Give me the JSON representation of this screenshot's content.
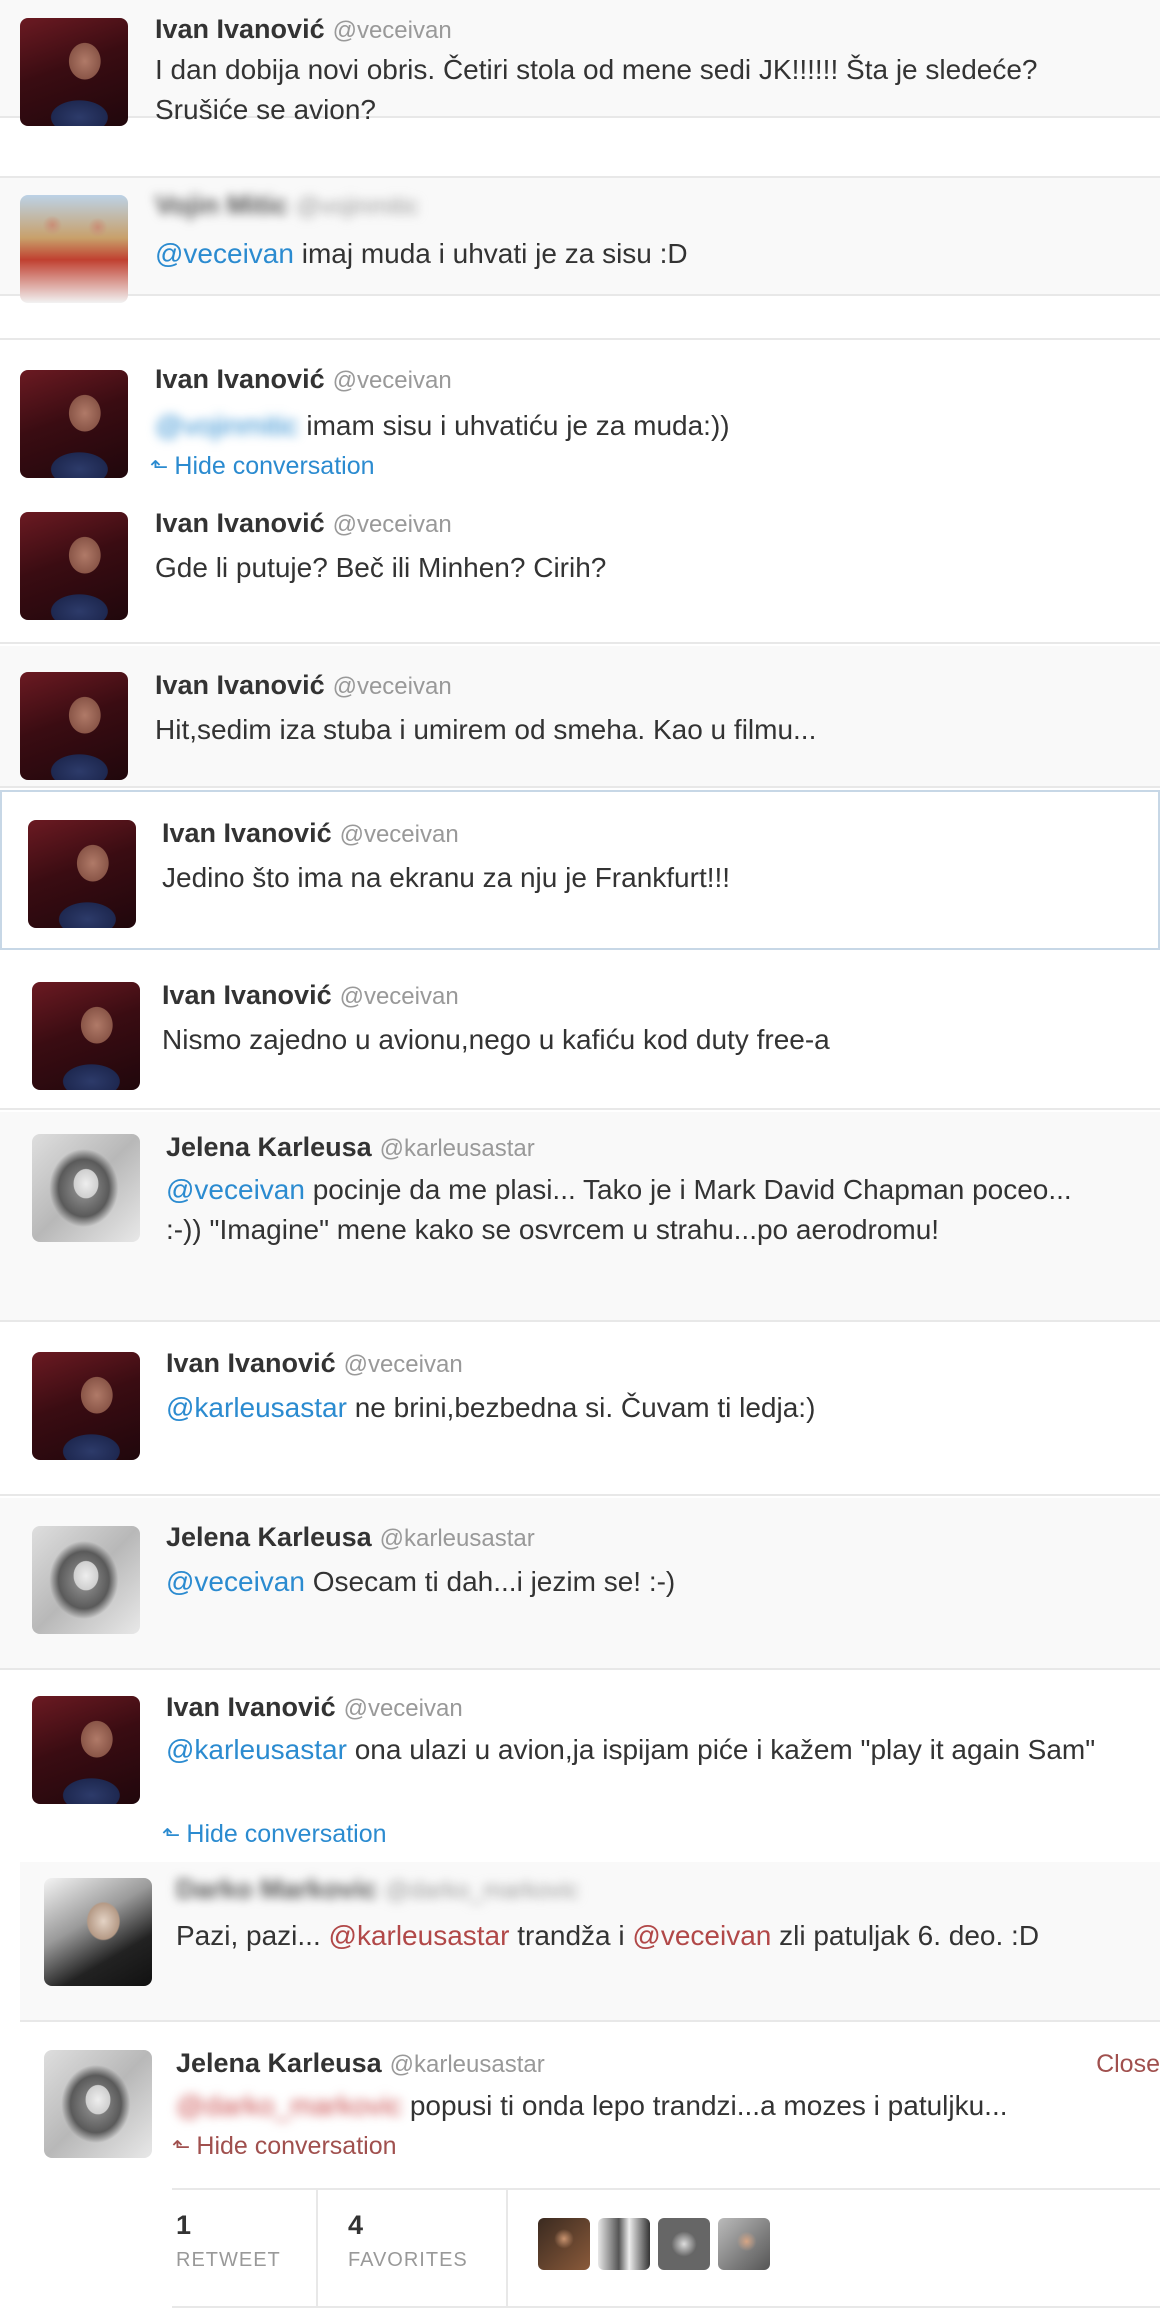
{
  "tweets": [
    {
      "name": "Ivan Ivanović",
      "handle": "@veceivan",
      "text": "I dan dobija novi obris. Četiri stola od mene sedi JK!!!!!! Šta je sledeće? Srušiće se avion?"
    },
    {
      "name": "Vojin Mitic",
      "handle": "@vojinmitic",
      "mention": "@veceivan",
      "text": " imaj muda i uhvati je za sisu :D"
    },
    {
      "name": "Ivan Ivanović",
      "handle": "@veceivan",
      "mention": "@vojinmitic",
      "text": " imam sisu i uhvatiću je za muda:))",
      "action": "Hide conversation"
    },
    {
      "name": "Ivan Ivanović",
      "handle": "@veceivan",
      "text": "Gde li putuje? Beč ili Minhen? Cirih?"
    },
    {
      "name": "Ivan Ivanović",
      "handle": "@veceivan",
      "text": "Hit,sedim iza stuba i umirem od smeha. Kao u filmu..."
    },
    {
      "name": "Ivan Ivanović",
      "handle": "@veceivan",
      "text": "Jedino što ima na ekranu za nju je Frankfurt!!!"
    },
    {
      "name": "Ivan Ivanović",
      "handle": "@veceivan",
      "text": "Nismo zajedno u avionu,nego u kafiću kod duty free-a"
    },
    {
      "name": "Jelena Karleusa",
      "handle": "@karleusastar",
      "mention": "@veceivan",
      "text": " pocinje da me plasi... Tako je i Mark David Chapman poceo... :-)) \"Imagine\" mene kako se osvrcem u strahu...po aerodromu!"
    },
    {
      "name": "Ivan Ivanović",
      "handle": "@veceivan",
      "mention": "@karleusastar",
      "text": " ne brini,bezbedna si. Čuvam ti ledja:)"
    },
    {
      "name": "Jelena Karleusa",
      "handle": "@karleusastar",
      "mention": "@veceivan",
      "text": " Osecam ti dah...i jezim se! :-)"
    },
    {
      "name": "Ivan Ivanović",
      "handle": "@veceivan",
      "mention": "@karleusastar",
      "text": " ona ulazi u avion,ja ispijam piće i kažem \"play it again Sam\"",
      "action": "Hide conversation"
    },
    {
      "name": "Darko Markovic",
      "handle": "@darko_markovic",
      "text_a": "Pazi, pazi... ",
      "mention_a": "@karleusastar",
      "text_b": " trandža i ",
      "mention_b": "@veceivan",
      "text_c": " zli patuljak 6. deo. :D"
    },
    {
      "name": "Jelena Karleusa",
      "handle": "@karleusastar",
      "mention": "@darko_markovic",
      "text": " popusi ti onda lepo trandzi...a mozes i patuljku...",
      "action": "Hide conversation",
      "close": "Close"
    }
  ],
  "stats": {
    "retweets": {
      "num": "1",
      "label": "RETWEET"
    },
    "favorites": {
      "num": "4",
      "label": "FAVORITES"
    }
  },
  "icons": {
    "hide_arrow": "reply-arrow-icon"
  }
}
